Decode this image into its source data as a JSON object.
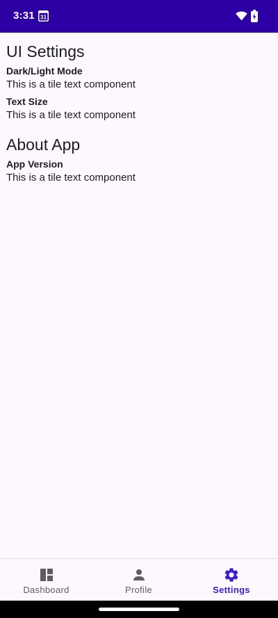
{
  "status_bar": {
    "time": "3:31",
    "calendar_day": "31",
    "background": "#2d00a5"
  },
  "sections": [
    {
      "title": "UI Settings",
      "tiles": [
        {
          "title": "Dark/Light Mode",
          "text": "This is a tile text component"
        },
        {
          "title": "Text Size",
          "text": "This is a tile text component"
        }
      ]
    },
    {
      "title": "About App",
      "tiles": [
        {
          "title": "App Version",
          "text": "This is a tile text component"
        }
      ]
    }
  ],
  "bottom_nav": {
    "items": [
      {
        "label": "Dashboard",
        "icon": "dashboard-icon",
        "active": false
      },
      {
        "label": "Profile",
        "icon": "person-icon",
        "active": false
      },
      {
        "label": "Settings",
        "icon": "gear-icon",
        "active": true
      }
    ],
    "active_color": "#3c1bd0",
    "inactive_color": "#5f5b64"
  }
}
